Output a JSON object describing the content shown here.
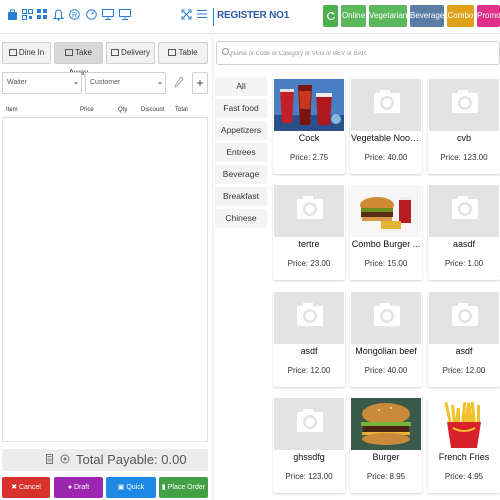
{
  "topbar": {
    "register_label": "REGISTER NO1",
    "icons": [
      "briefcase-icon",
      "qrcode-icon",
      "grid-icon",
      "bell-icon",
      "registered-icon",
      "dashboard-icon",
      "monitor-icon",
      "desktop-icon",
      "fullscreen-icon",
      "menu-icon"
    ],
    "filters": [
      {
        "label": "",
        "color": "#4cae4c"
      },
      {
        "label": "Online",
        "color": "#5cb85c"
      },
      {
        "label": "Vegetarian",
        "color": "#5cb85c"
      },
      {
        "label": "Beverage",
        "color": "#5a7ea3"
      },
      {
        "label": "Combo",
        "color": "#e0a21b"
      },
      {
        "label": "Promo",
        "color": "#e0308a"
      }
    ]
  },
  "order": {
    "tabs": [
      "Dine In",
      "Take Away",
      "Delivery",
      "Table"
    ],
    "active_tab": "Take Away",
    "waiter_label": "Waiter",
    "customer_label": "Customer",
    "add_label": "+",
    "columns": [
      "Item",
      "Price",
      "Qty",
      "Discount",
      "Total"
    ],
    "total_label": "Total Payable: 0.00"
  },
  "actions": [
    {
      "label": "Cancel",
      "color": "#d9312b"
    },
    {
      "label": "Draft",
      "color": "#9b27b0"
    },
    {
      "label": "Quick Invoice",
      "color": "#1e88e5"
    },
    {
      "label": "Place Order",
      "color": "#43a047"
    }
  ],
  "search": {
    "placeholder": "Name or Code or Category or VEG or BEV or BAR"
  },
  "categories": [
    "All",
    "Fast food",
    "Appetizers",
    "Entrees",
    "Beverage",
    "Breakfast",
    "Chinese"
  ],
  "products": [
    {
      "name": "Cock",
      "price": "Price: 2.75",
      "image": "cola-drinks"
    },
    {
      "name": "Vegetable Noodl...",
      "price": "Price: 40.00",
      "image": "camera-placeholder"
    },
    {
      "name": "cvb",
      "price": "Price: 123.00",
      "image": "camera-placeholder"
    },
    {
      "name": "tertre",
      "price": "Price: 23.00",
      "image": "camera-placeholder"
    },
    {
      "name": "Combo Burger ...",
      "price": "Price: 15.00",
      "image": "burger-combo"
    },
    {
      "name": "aasdf",
      "price": "Price: 1.00",
      "image": "camera-placeholder"
    },
    {
      "name": "asdf",
      "price": "Price: 12.00",
      "image": "camera-placeholder"
    },
    {
      "name": "Mongolian beef",
      "price": "Price: 40.00",
      "image": "camera-placeholder"
    },
    {
      "name": "asdf",
      "price": "Price: 12.00",
      "image": "camera-placeholder"
    },
    {
      "name": "ghssdfg",
      "price": "Price: 123.00",
      "image": "camera-placeholder"
    },
    {
      "name": "Burger",
      "price": "Price: 8.95",
      "image": "burger"
    },
    {
      "name": "French Fries",
      "price": "Price: 4.95",
      "image": "french-fries"
    }
  ]
}
